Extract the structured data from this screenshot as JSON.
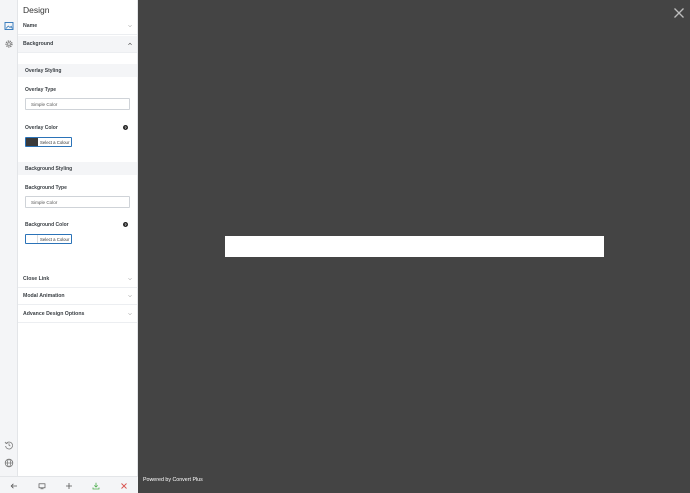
{
  "panel": {
    "title": "Design",
    "sections": [
      {
        "label": "Name",
        "expanded": false
      },
      {
        "label": "Background",
        "expanded": true
      },
      {
        "label": "Close Link",
        "expanded": false
      },
      {
        "label": "Modal Animation",
        "expanded": false
      },
      {
        "label": "Advance Design Options",
        "expanded": false
      }
    ]
  },
  "background": {
    "overlay_styling": "Overlay Styling",
    "overlay_type_label": "Overlay Type",
    "overlay_type_value": "Simple Color",
    "overlay_color_label": "Overlay Color",
    "overlay_color_button": "Select a Colour",
    "overlay_color_value": "#3a3a3a",
    "background_styling": "Background Styling",
    "background_type_label": "Background Type",
    "background_type_value": "Simple Color",
    "background_color_label": "Background Color",
    "background_color_button": "Select a Colour",
    "background_color_value": "#ffffff",
    "help_glyph": "?"
  },
  "rail_icons": [
    "design-icon",
    "settings-icon",
    "history-icon",
    "globe-icon"
  ],
  "toolbar_icons": [
    "back-arrow-icon",
    "preview-icon",
    "add-icon",
    "download-icon",
    "close-icon"
  ],
  "canvas": {
    "footer": "Powered by Convert Plus",
    "close_glyph": "×"
  },
  "colors": {
    "canvas_bg": "#444444",
    "accent": "#2b73b8",
    "save_green": "#4cae4c",
    "close_red": "#d9534f"
  }
}
